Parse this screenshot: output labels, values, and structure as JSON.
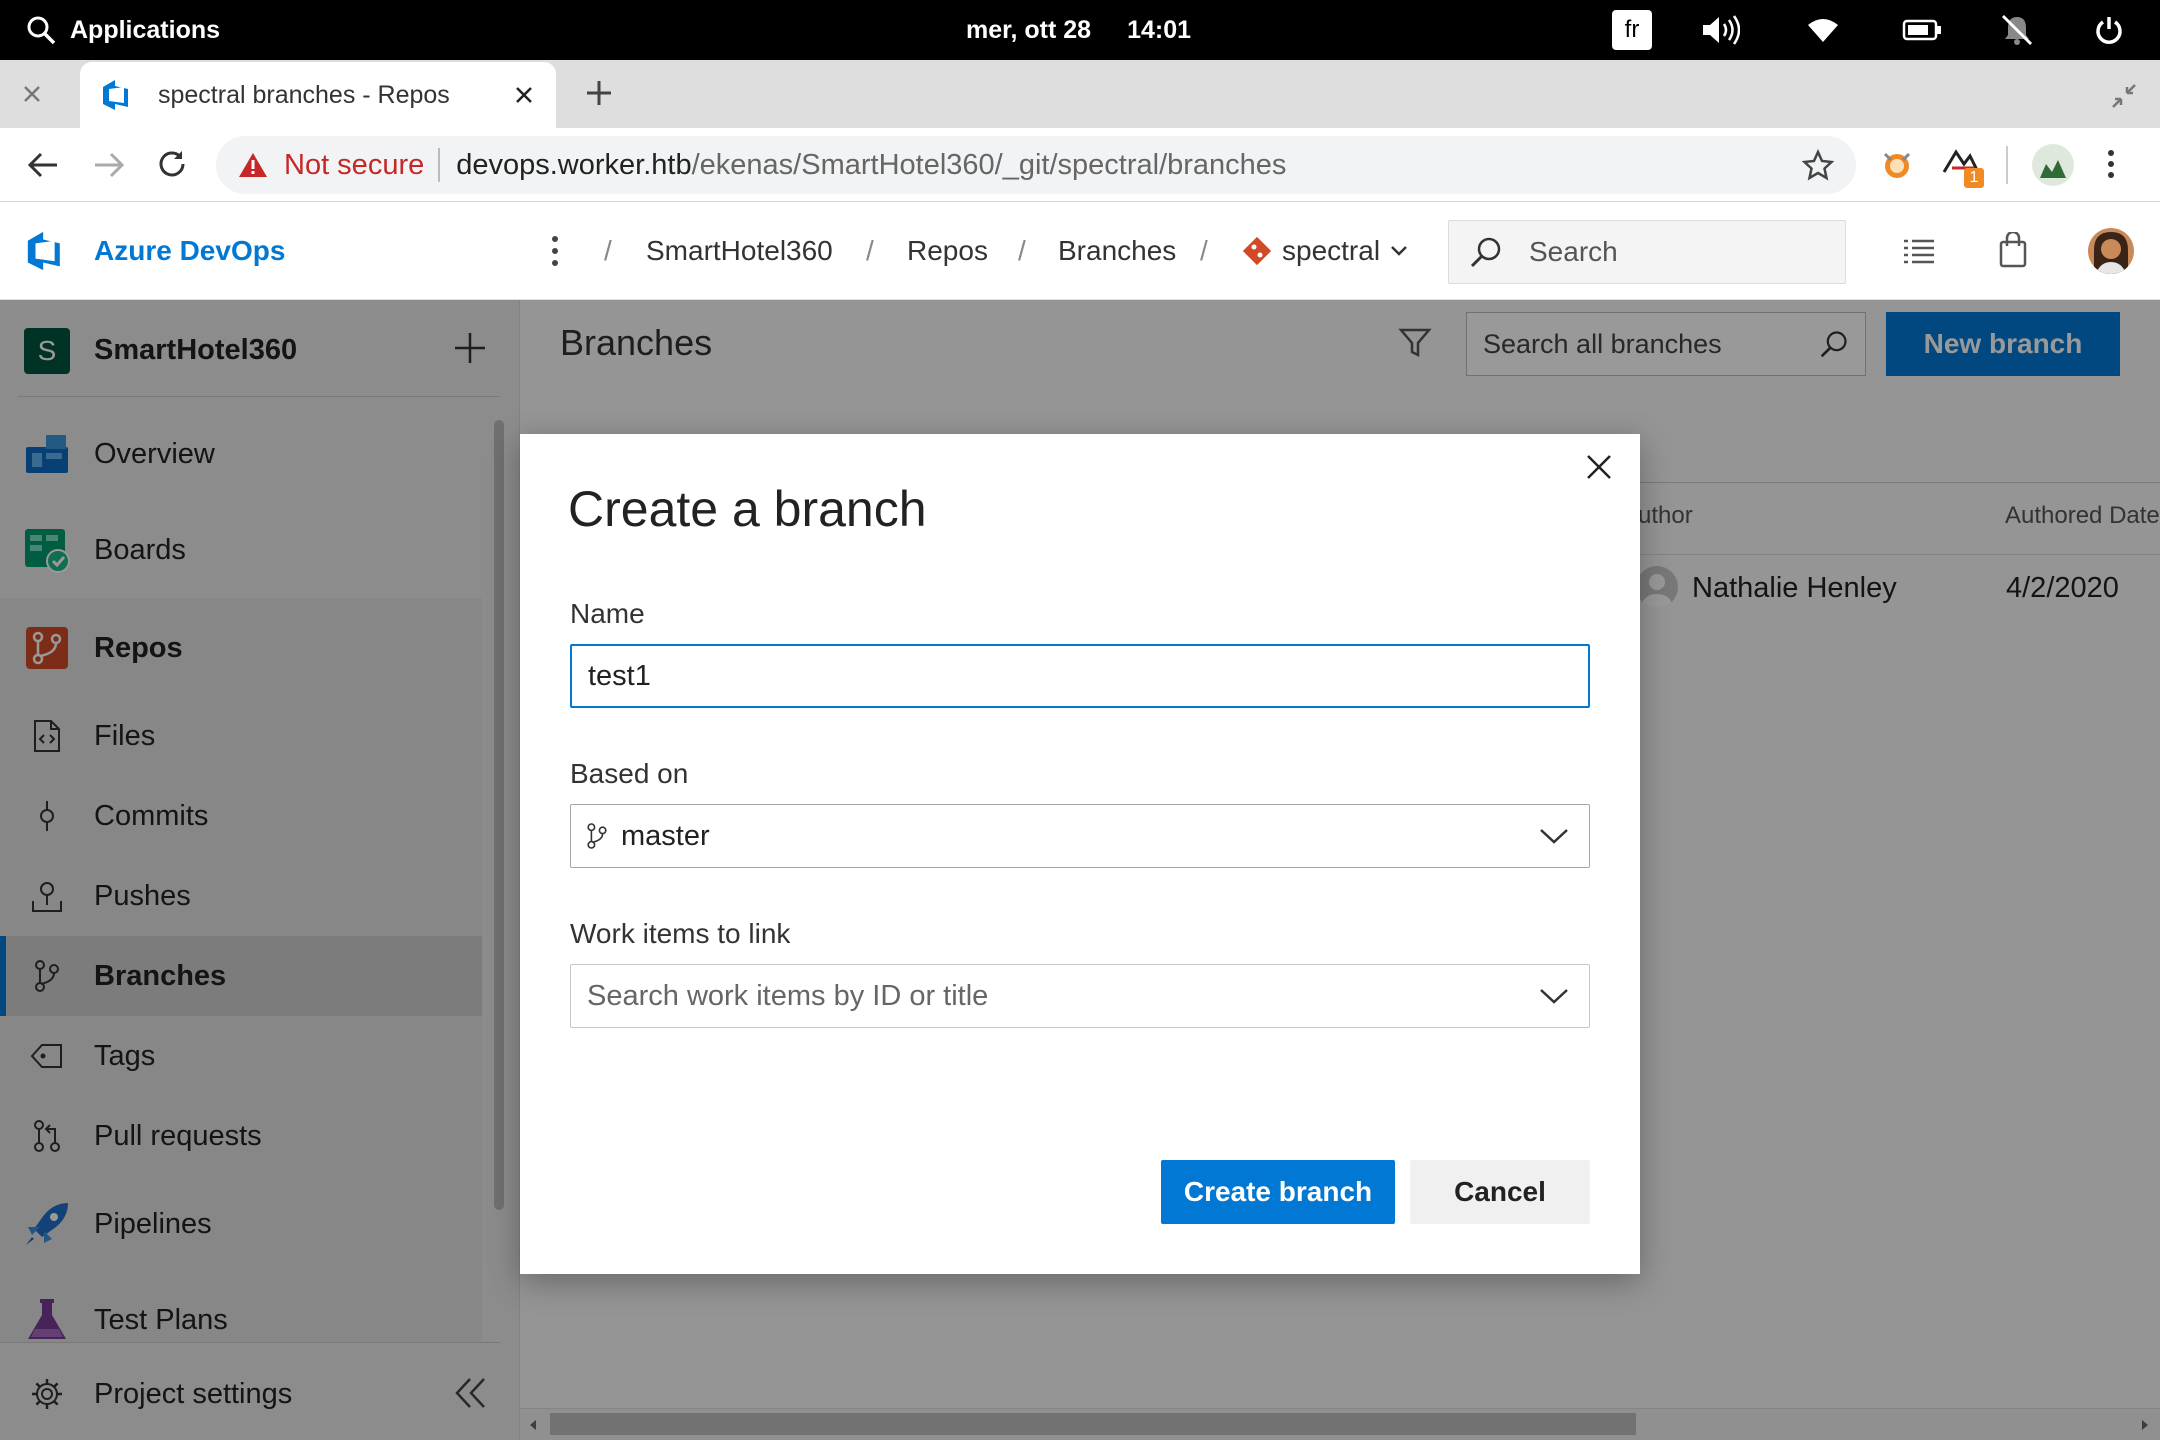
{
  "system_bar": {
    "applications_label": "Applications",
    "date": "mer, ott 28",
    "time": "14:01",
    "keyboard_layout": "fr"
  },
  "browser": {
    "tab_title": "spectral branches - Repos",
    "security_label": "Not secure",
    "url_host": "devops.worker.htb",
    "url_path": "/ekenas/SmartHotel360/_git/spectral/branches",
    "extension_badge": "1"
  },
  "ado_header": {
    "brand": "Azure DevOps",
    "breadcrumbs": [
      "SmartHotel360",
      "Repos",
      "Branches"
    ],
    "repo_name": "spectral",
    "search_placeholder": "Search"
  },
  "sidebar": {
    "project_initial": "S",
    "project_name": "SmartHotel360",
    "items": [
      {
        "label": "Overview"
      },
      {
        "label": "Boards"
      },
      {
        "label": "Repos"
      },
      {
        "label": "Files"
      },
      {
        "label": "Commits"
      },
      {
        "label": "Pushes"
      },
      {
        "label": "Branches"
      },
      {
        "label": "Tags"
      },
      {
        "label": "Pull requests"
      },
      {
        "label": "Pipelines"
      },
      {
        "label": "Test Plans"
      }
    ],
    "settings_label": "Project settings"
  },
  "branches_page": {
    "title": "Branches",
    "search_placeholder": "Search all branches",
    "new_branch_label": "New branch",
    "columns": [
      "uthor",
      "Authored Date"
    ],
    "rows": [
      {
        "author": "Nathalie Henley",
        "date": "4/2/2020"
      }
    ]
  },
  "dialog": {
    "title": "Create a branch",
    "name_label": "Name",
    "name_value": "test1",
    "based_on_label": "Based on",
    "based_on_value": "master",
    "work_items_label": "Work items to link",
    "work_items_placeholder": "Search work items by ID or title",
    "create_label": "Create branch",
    "cancel_label": "Cancel"
  },
  "colors": {
    "accent_blue": "#0078d4",
    "warning_red": "#c62828",
    "project_green": "#00563f"
  }
}
